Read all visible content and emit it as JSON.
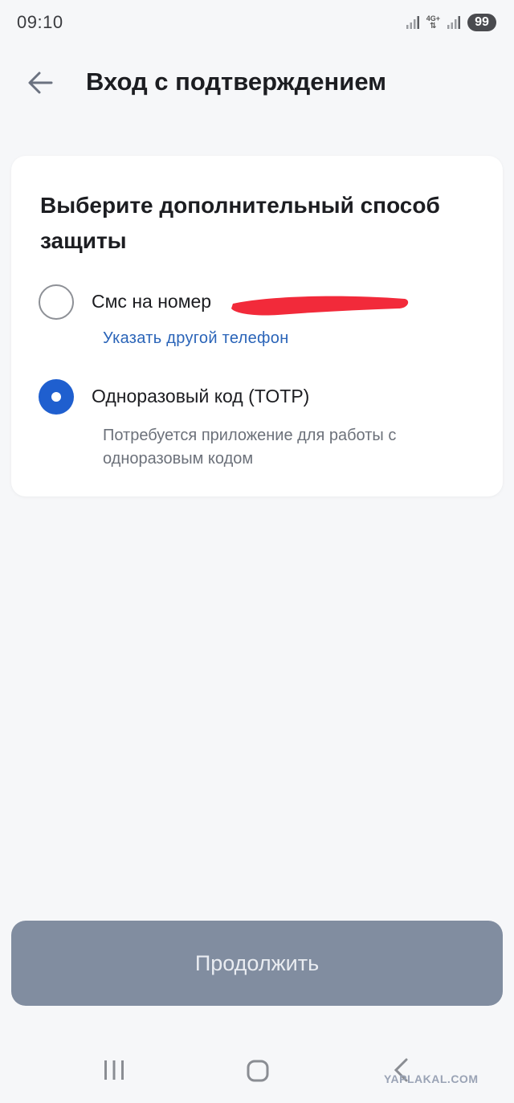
{
  "status_bar": {
    "time": "09:10",
    "network_label": "4G+",
    "battery": "99",
    "icons": [
      "signal-icon",
      "network-4g-icon",
      "signal-icon",
      "battery-icon"
    ]
  },
  "header": {
    "title": "Вход с подтверждением",
    "back_icon": "arrow-left-icon"
  },
  "card": {
    "title": "Выберите дополнительный способ защиты",
    "options": [
      {
        "label": "Смс на номер",
        "checked": false,
        "link": "Указать другой телефон"
      },
      {
        "label": "Одноразовый код (TOTP)",
        "checked": true,
        "hint": "Потребуется приложение для работы с одноразовым кодом"
      }
    ]
  },
  "continue_label": "Продолжить",
  "nav_bar": {
    "icons": [
      "recent-apps-icon",
      "home-icon",
      "back-icon"
    ]
  },
  "watermark": "YAPLAKAL.COM",
  "colors": {
    "accent": "#1f5fcf",
    "link": "#2a64b8",
    "button_disabled": "#818da0",
    "redaction": "#f22a3a"
  }
}
